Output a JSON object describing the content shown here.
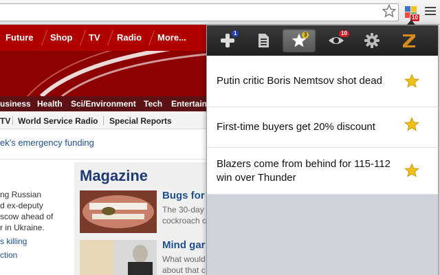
{
  "browser": {
    "extension_badge": "10",
    "icons": {
      "bookmark": "star-outline-icon",
      "extension": "puzzle-icon",
      "menu": "hamburger-menu-icon"
    }
  },
  "page": {
    "nav": [
      "Future",
      "Shop",
      "TV",
      "Radio",
      "More..."
    ],
    "subnav": [
      "usiness",
      "Health",
      "Sci/Environment",
      "Tech",
      "Entertain"
    ],
    "subnav2": [
      "TV",
      "World Service Radio",
      "Special Reports"
    ],
    "headline_link": "ek's emergency funding",
    "left_text": [
      "ng Russian",
      "d ex-deputy",
      "scow ahead of",
      "r in Ukraine."
    ],
    "left_links": [
      "s killing",
      "ction"
    ],
    "magazine_title": "Magazine",
    "stories": [
      {
        "title": "Bugs for",
        "lines": [
          "The 30-day",
          "cockroach c"
        ]
      },
      {
        "title": "Mind gar",
        "lines": [
          "What would",
          "about that c"
        ]
      }
    ]
  },
  "popup": {
    "toolbar": [
      {
        "icon": "add-icon",
        "badge": "1",
        "badge_color": "#1f3fb8"
      },
      {
        "icon": "document-icon",
        "badge": "",
        "badge_color": ""
      },
      {
        "icon": "star-icon",
        "badge": "3",
        "badge_color": "#e3c21a",
        "active": true
      },
      {
        "icon": "eye-icon",
        "badge": "10",
        "badge_color": "#d21f27"
      },
      {
        "icon": "gear-icon",
        "badge": "",
        "badge_color": ""
      },
      {
        "icon": "z-logo-icon",
        "badge": "",
        "badge_color": ""
      }
    ],
    "items": [
      {
        "title": "Putin critic Boris Nemtsov shot dead",
        "icon": "favorite-star-icon"
      },
      {
        "title": "First-time buyers get 20% discount",
        "icon": "favorite-star-icon"
      },
      {
        "title": "Blazers come from behind for 115-112 win over Thunder",
        "icon": "favorite-star-icon"
      }
    ]
  },
  "colors": {
    "bbc_red": "#b00000",
    "popup_dark": "#2b2b2b",
    "star_gold": "#f2c118"
  }
}
